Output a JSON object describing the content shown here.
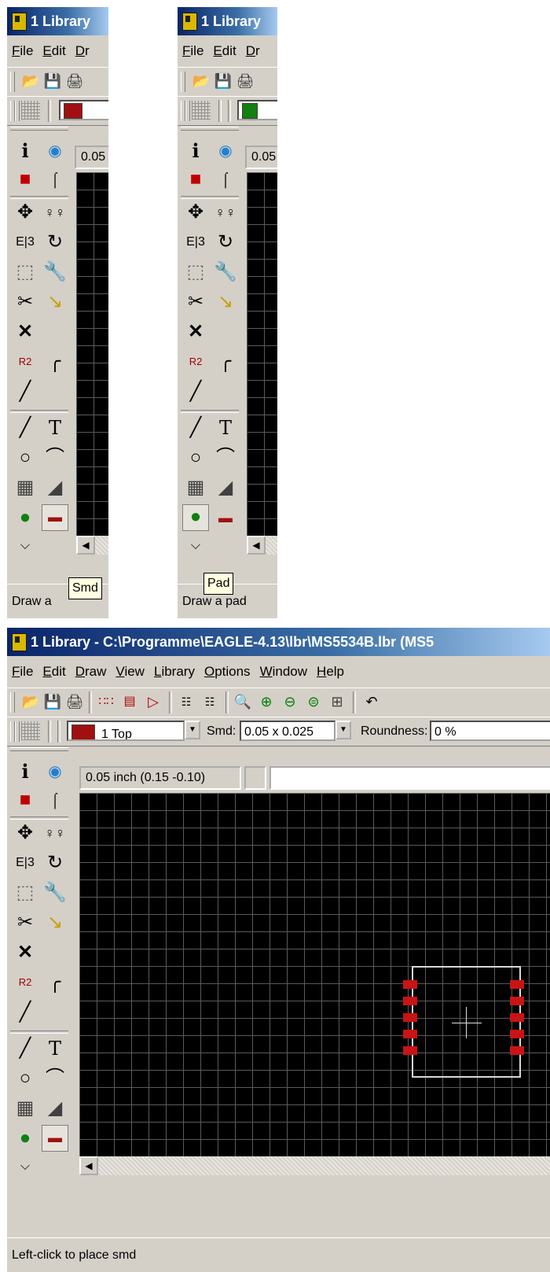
{
  "window": {
    "title_short": "1 Library",
    "title_full": "1 Library - C:\\Programme\\EAGLE-4.13\\lbr\\MS5534B.lbr (MS5"
  },
  "menu": {
    "items": [
      "File",
      "Edit",
      "Draw",
      "View",
      "Library",
      "Options",
      "Window",
      "Help"
    ],
    "cropped_items": [
      "File",
      "Edit",
      "Dr"
    ]
  },
  "param_bar": {
    "layer": "1 Top",
    "smd_label": "Smd:",
    "smd_value": "0.05 x 0.025",
    "roundness_label": "Roundness:",
    "roundness_value": "0 %"
  },
  "coords": {
    "full": "0.05 inch (0.15 -0.10)",
    "short": "0.05"
  },
  "panels": [
    {
      "tooltip": "Smd",
      "status": "Draw a ",
      "active_tool": "smd-tool"
    },
    {
      "tooltip": "Pad",
      "status": "Draw a pad",
      "active_tool": "pad-tool"
    }
  ],
  "main": {
    "status": "Left-click to place smd",
    "active_tool": "smd-tool"
  },
  "colors": {
    "titlebar": "#0a246a",
    "canvas": "#000000",
    "grid": "#5a5a5a",
    "smd_pad": "#c81414",
    "layer_top": "#a01010",
    "layer_pad": "#108010",
    "tooltip_bg": "#ffffe1"
  },
  "icons": {
    "toolbar": [
      "open-folder-icon",
      "save-disk-icon",
      "print-icon",
      "board-icon",
      "package-icon",
      "symbol-icon",
      "script-icon",
      "ulp-icon",
      "zoom-fit-icon",
      "zoom-in-icon",
      "zoom-out-icon",
      "zoom-redraw-icon",
      "zoom-select-icon",
      "undo-icon"
    ],
    "tools": [
      "info-icon",
      "show-icon",
      "display-icon",
      "mark-icon",
      "move-icon",
      "copy-icon",
      "mirror-icon",
      "rotate-icon",
      "group-icon",
      "change-icon",
      "split-icon",
      "miter-icon",
      "delete-icon",
      "name-icon",
      "smash-icon",
      "optimize-icon",
      "wire-icon",
      "text-icon",
      "circle-icon",
      "arc-icon",
      "rect-icon",
      "polygon-icon",
      "pad-icon",
      "smd-icon",
      "more-icon"
    ]
  }
}
